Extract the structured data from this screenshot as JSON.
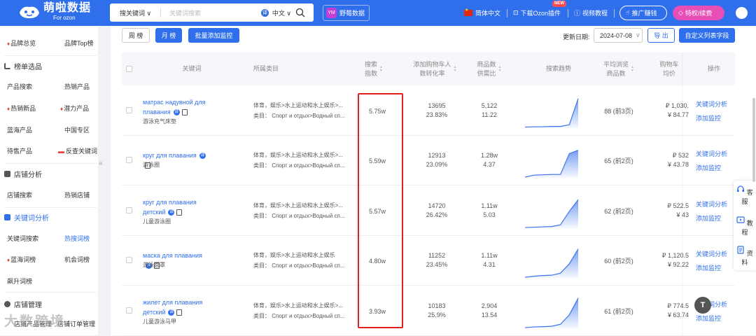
{
  "app": {
    "brand": "萌啦数据",
    "brand_sub": "For ozon"
  },
  "search": {
    "type": "搜关键词",
    "placeholder": "关键词搜索",
    "lang_icon": "译",
    "lang": "中文"
  },
  "topnav": {
    "yemei_icon": "YM",
    "yemei": "野莓数据",
    "lang": "简体中文",
    "plugin": "下载Ozon插件",
    "plugin_badge": "NEW",
    "tutorial": "视频教程",
    "promote": "推广赚钱",
    "vip": "特权/续费"
  },
  "sidebar": {
    "top": [
      {
        "c1": "品牌总览",
        "c2": "品牌Top榜"
      }
    ],
    "sections": [
      {
        "title": "榜单选品",
        "rows": [
          {
            "c1": "产品搜索",
            "c2": "热销产品"
          },
          {
            "c1": "热销新品",
            "c2": "潜力产品"
          },
          {
            "c1": "蓝海产品",
            "c2": "中国专区"
          },
          {
            "c1": "待售产品",
            "c2": "反查关键词"
          }
        ]
      },
      {
        "title": "店铺分析",
        "rows": [
          {
            "c1": "店铺搜索",
            "c2": "热销店铺"
          }
        ]
      },
      {
        "title": "关键词分析",
        "rows": [
          {
            "c1": "关键词搜索",
            "c2": "热搜词榜"
          },
          {
            "c1": "蓝海词榜",
            "c2": "机会词榜"
          },
          {
            "c1": "飙升词榜",
            "c2": ""
          }
        ]
      },
      {
        "title": "店铺管理",
        "rows": [
          {
            "c1": "店铺产品管理",
            "c2": "店铺订单管理"
          }
        ]
      }
    ],
    "collapse": "«"
  },
  "toolbar": {
    "week": "周 榜",
    "month": "月 榜",
    "batch": "批量添加监控",
    "update_label": "更新日期:",
    "date": "2024-07-08",
    "export": "导 出",
    "custom": "自定义列表字段"
  },
  "table": {
    "headers": {
      "keyword": "关键词",
      "category": "所属类目",
      "search_1": "搜索",
      "search_2": "指数",
      "cart_1": "添加购物车人",
      "cart_2": "数转化率",
      "goods_1": "商品数",
      "goods_2": "供需比",
      "trend": "搜索趋势",
      "browse_1": "平均浏览",
      "browse_2": "商品数",
      "cartprice_1": "购物车",
      "cartprice_2": "均价",
      "ops": "操作"
    },
    "rows": [
      {
        "kw": "матрас надувной для плавания",
        "kw_cn": "游泳充气床垫",
        "cat1": "体育，娱乐>水上运动和水上娱乐>...",
        "cat2": "类目：  Спорт и отдых>Водный сп...",
        "search": "5.75w",
        "cart1": "13695",
        "cart2": "23.83%",
        "goods1": "5,122",
        "goods2": "11.22",
        "browse": "88 (前3页)",
        "price1": "₽ 1,030.",
        "price2": "¥ 84.77",
        "op1": "关键词分析",
        "op2": "添加监控",
        "trend": [
          0.03,
          0.04,
          0.04,
          0.05,
          0.05,
          0.1,
          0.88
        ]
      },
      {
        "kw": "круг для плавания",
        "kw_cn": "游泳圈",
        "cat1": "体育，娱乐>水上运动和水上娱乐>...",
        "cat2": "类目：  Спорт и отдых>Водный сп...",
        "search": "5.59w",
        "cart1": "12913",
        "cart2": "23.09%",
        "goods1": "1.28w",
        "goods2": "4.37",
        "browse": "65 (前2页)",
        "price1": "₽ 532",
        "price2": "¥ 43.78",
        "op1": "关键词分析",
        "op2": "添加监控",
        "trend": [
          0.02,
          0.08,
          0.09,
          0.1,
          0.1,
          0.72,
          0.82
        ]
      },
      {
        "kw": "круг для плавания детский",
        "kw_cn": "儿童游泳圈",
        "cat1": "体育，娱乐>水上运动和水上娱乐>...",
        "cat2": "类目：  Спорт и отдых>Водный сп...",
        "search": "5.57w",
        "cart1": "14720",
        "cart2": "26.42%",
        "goods1": "1.11w",
        "goods2": "5.03",
        "browse": "62 (前2页)",
        "price1": "₽ 522.5",
        "price2": "¥ 43",
        "op1": "关键词分析",
        "op2": "添加监控",
        "trend": [
          0.02,
          0.03,
          0.04,
          0.05,
          0.1,
          0.5,
          0.85
        ]
      },
      {
        "kw": "маска для плавания",
        "kw_cn": "游泳面罩",
        "cat1": "体育，娱乐>水上运动和水上娱乐",
        "cat2": "类目：  Спорт и отдых>Водный сп...",
        "search": "4.80w",
        "cart1": "11252",
        "cart2": "23.45%",
        "goods1": "1.11w",
        "goods2": "4.31",
        "browse": "60 (前2页)",
        "price1": "₽ 1,120.5",
        "price2": "¥ 92.22",
        "op1": "关键词分析",
        "op2": "添加监控",
        "trend": [
          0.02,
          0.05,
          0.07,
          0.08,
          0.14,
          0.42,
          0.86
        ]
      },
      {
        "kw": "жилет для плавания детский",
        "kw_cn": "儿童游泳马甲",
        "cat1": "体育，娱乐>水上运动和水上娱乐>...",
        "cat2": "类目：  Спорт и отдых>Водный сп...",
        "search": "3.93w",
        "cart1": "10183",
        "cart2": "25.9%",
        "goods1": "2,904",
        "goods2": "13.54",
        "browse": "61 (前2页)",
        "price1": "₽ 774.5",
        "price2": "¥ 63.74",
        "op1": "关键词分析",
        "op2": "添加监控",
        "trend": [
          0.02,
          0.04,
          0.05,
          0.06,
          0.12,
          0.4,
          0.9
        ]
      }
    ]
  },
  "float_panel": {
    "service": "客服",
    "tutorial": "教程",
    "docs": "资料"
  },
  "to_top": "T",
  "watermark": "大数跨境",
  "colors": {
    "primary": "#2f6fec",
    "highlight": "#e02020",
    "vip": "#e74eb6"
  }
}
